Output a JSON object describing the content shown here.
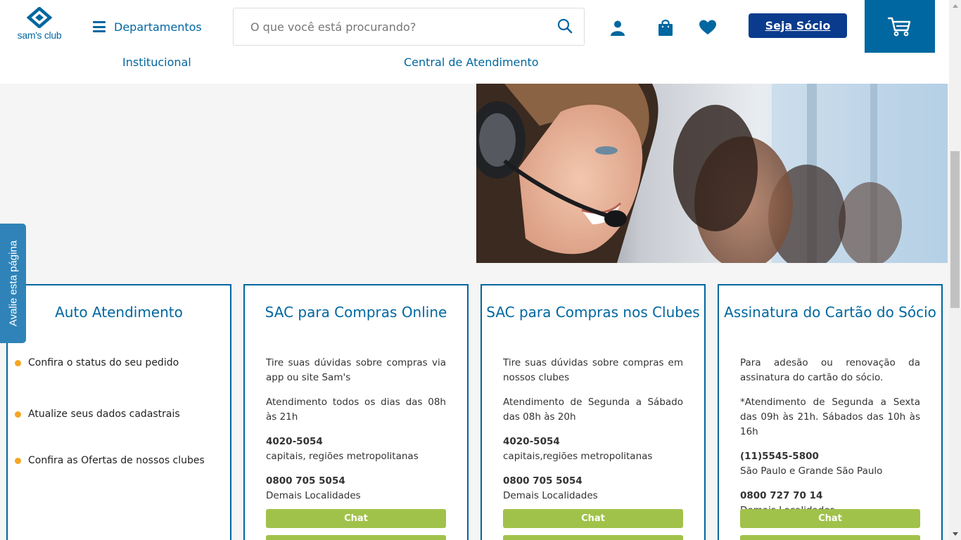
{
  "header": {
    "logo_text": "sam's club",
    "departments_label": "Departamentos",
    "search_placeholder": "O que você está procurando?",
    "socio_label": "Seja Sócio",
    "icons": [
      "search-icon",
      "user-icon",
      "bag-icon",
      "heart-icon",
      "cart-icon"
    ],
    "colors": {
      "brand": "#0067a0",
      "socio": "#0a3b8c",
      "chat": "#a0c24a",
      "bullet": "#f5a623"
    }
  },
  "subnav": {
    "items": [
      {
        "label": "Institucional"
      },
      {
        "label": "Central de Atendimento"
      }
    ]
  },
  "feedback": {
    "label": "Avalie esta página"
  },
  "cards": [
    {
      "title": "Auto Atendimento",
      "bullets": [
        "Confira o status do seu pedido",
        "Atualize seus dados cadastrais",
        "Confira as Ofertas de nossos clubes"
      ]
    },
    {
      "title": "SAC para Compras Online",
      "desc": "Tire suas dúvidas sobre compras via app ou site Sam's",
      "hours": "Atendimento todos os dias das 08h às 21h",
      "phone1": "4020-5054",
      "phone1_desc": "capitais, regiões metropolitanas",
      "phone2": "0800 705 5054",
      "phone2_desc": "Demais Localidades",
      "chat_label": "Chat"
    },
    {
      "title": "SAC para Compras nos Clubes",
      "desc": "Tire suas dúvidas sobre compras em nossos clubes",
      "hours": "Atendimento de Segunda a Sábado das 08h às 20h",
      "phone1": "4020-5054",
      "phone1_desc": "capitais,regiões metropolitanas",
      "phone2": "0800 705 5054",
      "phone2_desc": "Demais Localidades",
      "chat_label": "Chat"
    },
    {
      "title": "Assinatura do Cartão do Sócio",
      "desc": "Para adesão ou renovação da assinatura do cartão do sócio.",
      "hours": "*Atendimento de Segunda a Sexta das 09h às 21h. Sábados das 10h às 16h",
      "phone1": "(11)5545-5800",
      "phone1_desc": "São Paulo e Grande São Paulo",
      "phone2": "0800 727 70 14",
      "phone2_desc": "Demais Localidades",
      "chat_label": "Chat"
    }
  ]
}
